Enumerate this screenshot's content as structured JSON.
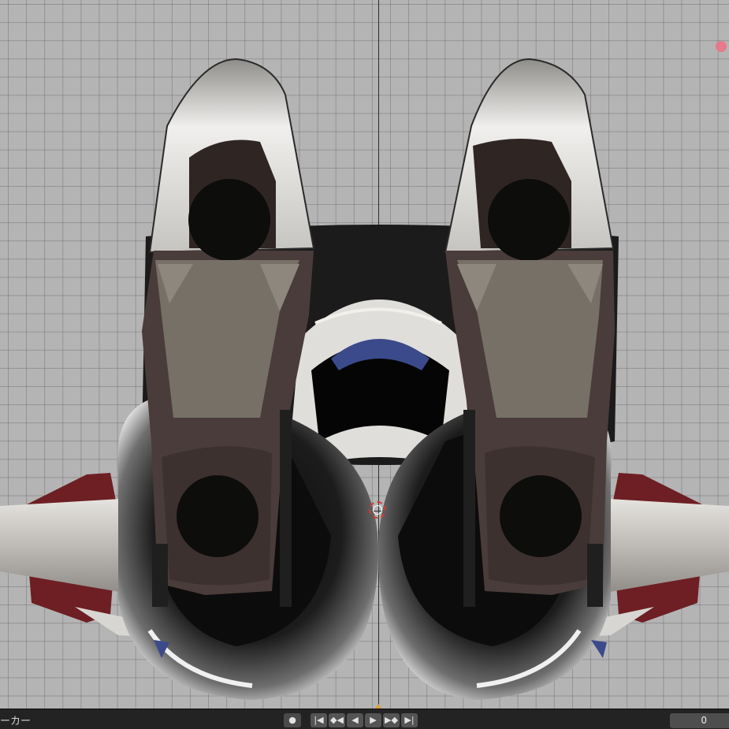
{
  "viewport": {
    "background_color": "#b4b4b4",
    "grid_color": "#7a7a7a",
    "light_dot_color": "#e57a8a",
    "cursor_color": "#d33a2f"
  },
  "timeline": {
    "marker_label": "ーカー",
    "controls": [
      {
        "name": "record-button",
        "glyph": "●"
      },
      {
        "name": "jump-to-start-button",
        "glyph": "|◀"
      },
      {
        "name": "prev-keyframe-button",
        "glyph": "◆◀"
      },
      {
        "name": "play-reverse-button",
        "glyph": "◀"
      },
      {
        "name": "play-button",
        "glyph": "▶"
      },
      {
        "name": "next-keyframe-button",
        "glyph": "▶◆"
      },
      {
        "name": "jump-to-end-button",
        "glyph": "▶|"
      }
    ],
    "current_frame": "0",
    "playhead_color": "#e0a036"
  }
}
